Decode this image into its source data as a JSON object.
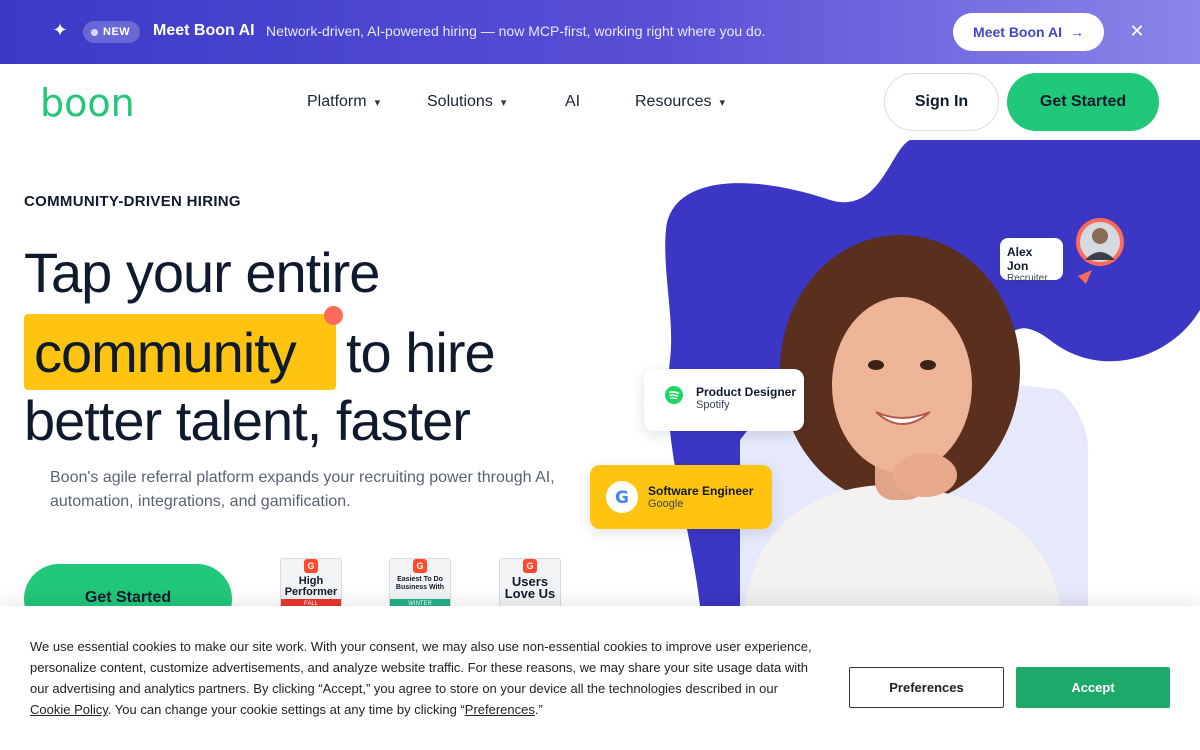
{
  "announcement": {
    "badge": "NEW",
    "title": "Meet Boon AI",
    "text": "Network-driven, AI-powered hiring — now MCP-first, working right where you do.",
    "cta_label": "Meet Boon AI",
    "cta_arrow": "→",
    "close_glyph": "✕",
    "sparkle_glyph": "✦"
  },
  "nav": {
    "logo_text": "boon",
    "items": [
      {
        "label": "Platform",
        "has_dropdown": true
      },
      {
        "label": "Solutions",
        "has_dropdown": true
      },
      {
        "label": "AI",
        "has_dropdown": false
      },
      {
        "label": "Resources",
        "has_dropdown": true
      }
    ],
    "chevron_glyph": "⌄",
    "signin_label": "Sign In",
    "get_started_label": "Get Started"
  },
  "hero": {
    "eyebrow": "COMMUNITY-DRIVEN HIRING",
    "line1": "Tap your entire",
    "highlight_word": "community",
    "line2_rest": "to hire",
    "line3": "better talent, faster",
    "description": "Boon's agile referral platform expands your recruiting power  through AI, automation, integrations, and gamification.",
    "cta_label": "Get Started",
    "badges": [
      {
        "g2": "G",
        "text": "High Performer",
        "ribbon": "FALL",
        "ribbon_color": "#e8372c"
      },
      {
        "g2": "G",
        "text": "Easiest To Do Business With",
        "ribbon": "WINTER",
        "ribbon_color": "#21b08a"
      },
      {
        "g2": "G",
        "text": "Users Love Us",
        "ribbon": "",
        "ribbon_color": "#c9ccd2"
      }
    ]
  },
  "hero_cards": {
    "recruiter": {
      "name": "Alex Jon",
      "role": "Recruiter"
    },
    "spotify": {
      "title": "Product Designer",
      "company": "Spotify"
    },
    "google": {
      "title": "Software Engineer",
      "company": "Google"
    }
  },
  "colors": {
    "brand_green": "#22c87a",
    "brand_purple": "#3b36c4",
    "highlight_yellow": "#ffc412",
    "accent_coral": "#ff6b5a"
  },
  "cookie": {
    "text_before_link": "We use essential cookies to make our site work. With your consent, we may also use non-essential cookies to improve user experience, personalize content, customize advertisements, and analyze website traffic. For these reasons, we may share your site usage data with our advertising and analytics partners. By clicking “Accept,” you agree to store on your device all the technologies described in our ",
    "link_policy": "Cookie Policy",
    "text_middle": ". You can change your cookie settings at any time by clicking “",
    "link_prefs": "Preferences",
    "text_end": ".”",
    "preferences_label": "Preferences",
    "accept_label": "Accept"
  }
}
